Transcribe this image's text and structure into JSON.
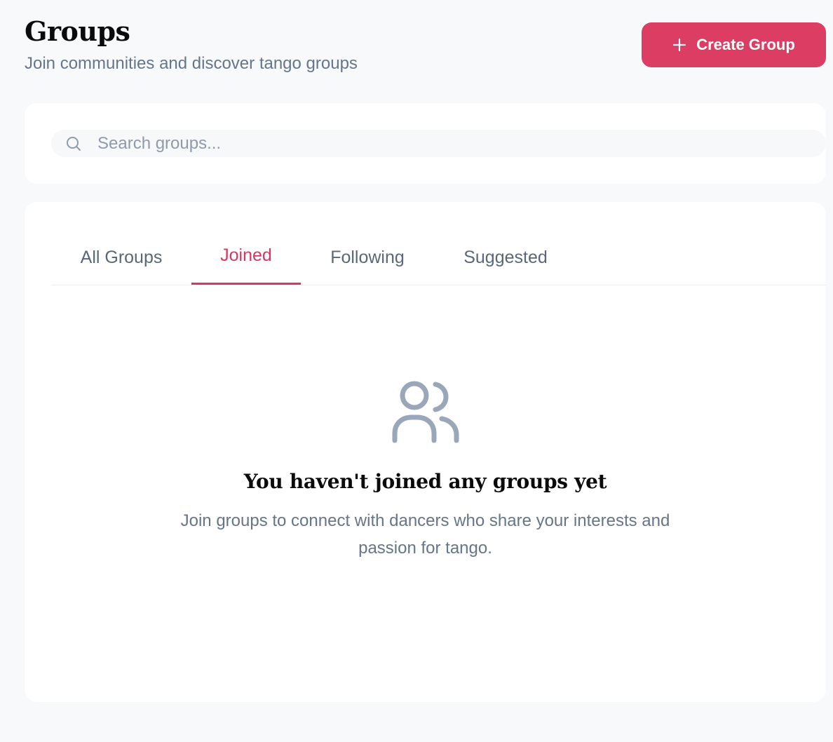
{
  "header": {
    "title": "Groups",
    "subtitle": "Join communities and discover tango groups"
  },
  "actions": {
    "create_group_label": "Create Group",
    "create_icon": "plus-icon"
  },
  "search": {
    "placeholder": "Search groups...",
    "value": "",
    "icon": "search-icon"
  },
  "tabs": [
    {
      "label": "All Groups",
      "active": false
    },
    {
      "label": "Joined",
      "active": true
    },
    {
      "label": "Following",
      "active": false
    },
    {
      "label": "Suggested",
      "active": false
    }
  ],
  "empty_state": {
    "icon": "users-icon",
    "title": "You haven't joined any groups yet",
    "description": "Join groups to connect with dancers who share your interests and passion for tango."
  },
  "colors": {
    "accent": "#dc3d63",
    "active_tab": "#d8385e",
    "muted_text": "#66758a",
    "icon_gray": "#9aa7b8",
    "background": "#f8f9fb"
  }
}
